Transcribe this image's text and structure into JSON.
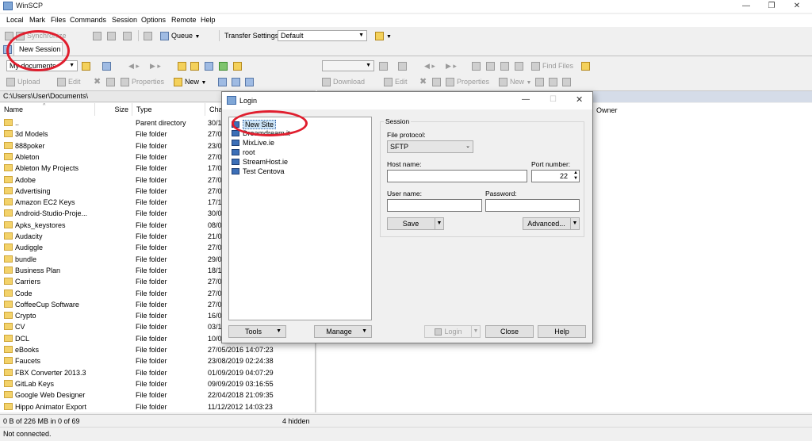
{
  "window": {
    "title": "WinSCP",
    "controls": [
      "—",
      "❐",
      "✕"
    ]
  },
  "menu": [
    "Local",
    "Mark",
    "Files",
    "Commands",
    "Session",
    "Options",
    "Remote",
    "Help"
  ],
  "toolbar": {
    "synchronize": "Synchronize",
    "queue": "Queue",
    "transfer_settings_label": "Transfer Settings",
    "transfer_settings_value": "Default"
  },
  "session_tab": {
    "label": "New Session"
  },
  "local_toolbar": {
    "location": "My documents",
    "upload": "Upload",
    "edit": "Edit",
    "properties": "Properties",
    "new": "New"
  },
  "remote_toolbar": {
    "find_files": "Find Files",
    "download": "Download",
    "edit": "Edit",
    "properties": "Properties",
    "new": "New"
  },
  "local_path": "C:\\Users\\User\\Documents\\",
  "columns": {
    "name": "Name",
    "size": "Size",
    "type": "Type",
    "changed": "Cha",
    "owner": "Owner"
  },
  "files": [
    {
      "name": "..",
      "type": "Parent directory",
      "changed": "30/1"
    },
    {
      "name": "3d Models",
      "type": "File folder",
      "changed": "27/0"
    },
    {
      "name": "888poker",
      "type": "File folder",
      "changed": "23/0"
    },
    {
      "name": "Ableton",
      "type": "File folder",
      "changed": "27/0"
    },
    {
      "name": "Ableton My Projects",
      "type": "File folder",
      "changed": "17/0"
    },
    {
      "name": "Adobe",
      "type": "File folder",
      "changed": "27/0"
    },
    {
      "name": "Advertising",
      "type": "File folder",
      "changed": "27/0"
    },
    {
      "name": "Amazon EC2 Keys",
      "type": "File folder",
      "changed": "17/1"
    },
    {
      "name": "Android-Studio-Proje...",
      "type": "File folder",
      "changed": "30/0"
    },
    {
      "name": "Apks_keystores",
      "type": "File folder",
      "changed": "08/0"
    },
    {
      "name": "Audacity",
      "type": "File folder",
      "changed": "21/0"
    },
    {
      "name": "Audiggle",
      "type": "File folder",
      "changed": "27/0"
    },
    {
      "name": "bundle",
      "type": "File folder",
      "changed": "29/0"
    },
    {
      "name": "Business Plan",
      "type": "File folder",
      "changed": "18/1"
    },
    {
      "name": "Carriers",
      "type": "File folder",
      "changed": "27/0"
    },
    {
      "name": "Code",
      "type": "File folder",
      "changed": "27/0"
    },
    {
      "name": "CoffeeCup Software",
      "type": "File folder",
      "changed": "27/0"
    },
    {
      "name": "Crypto",
      "type": "File folder",
      "changed": "16/0"
    },
    {
      "name": "CV",
      "type": "File folder",
      "changed": "03/1"
    },
    {
      "name": "DCL",
      "type": "File folder",
      "changed": "10/0"
    },
    {
      "name": "eBooks",
      "type": "File folder",
      "changed": "27/05/2016 14:07:23"
    },
    {
      "name": "Faucets",
      "type": "File folder",
      "changed": "23/08/2019 02:24:38"
    },
    {
      "name": "FBX Converter 2013.3",
      "type": "File folder",
      "changed": "01/09/2019 04:07:29"
    },
    {
      "name": "GitLab Keys",
      "type": "File folder",
      "changed": "09/09/2019 03:16:55"
    },
    {
      "name": "Google Web Designer",
      "type": "File folder",
      "changed": "22/04/2018 21:09:35"
    },
    {
      "name": "Hippo Animator Export",
      "type": "File folder",
      "changed": "11/12/2012 14:03:23"
    }
  ],
  "status": {
    "selection": "0 B of 226 MB in 0 of 69",
    "hidden": "4 hidden",
    "connection": "Not connected."
  },
  "login": {
    "title": "Login",
    "sites": [
      "New Site",
      "Dreamdream.it",
      "MixLive.ie",
      "root",
      "StreamHost.ie",
      "Test Centova"
    ],
    "session_group": "Session",
    "file_protocol_label": "File protocol:",
    "file_protocol_value": "SFTP",
    "host_label": "Host name:",
    "port_label": "Port number:",
    "port_value": "22",
    "user_label": "User name:",
    "password_label": "Password:",
    "save": "Save",
    "advanced": "Advanced...",
    "tools": "Tools",
    "manage": "Manage",
    "login_btn": "Login",
    "close": "Close",
    "help": "Help"
  },
  "annotation_color": "#e01e2e"
}
